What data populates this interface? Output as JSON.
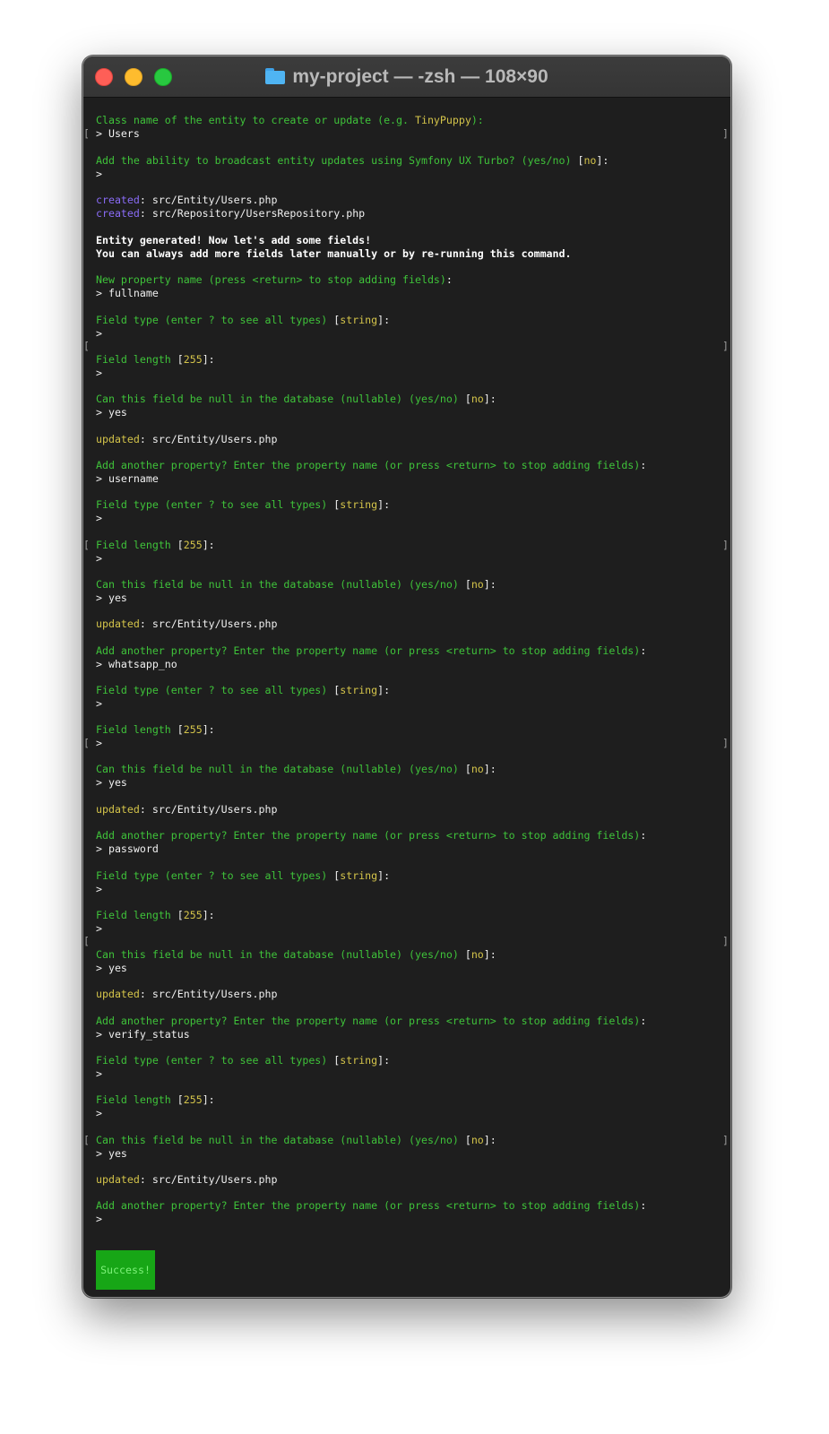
{
  "window": {
    "title": "my-project — -zsh — 108×90"
  },
  "prompt_symbol": "> ",
  "lines": {
    "l1": "Class name of the entity to create or update (e.g. ",
    "l1b": "TinyPuppy",
    "l1c": "):",
    "l2": "Users",
    "l3": "Add the ability to broadcast entity updates using Symfony UX Turbo? (yes/no) ",
    "l3b": "no",
    "l5a": "created",
    "l5b": ": src/Entity/Users.php",
    "l6a": "created",
    "l6b": ": src/Repository/UsersRepository.php",
    "l7": "Entity generated! Now let's add some fields!",
    "l8": "You can always add more fields later manually or by re-running this command.",
    "l9": "New property name (press <return> to stop adding fields)",
    "l10": "fullname",
    "field_type": "Field type (enter ? to see all types) ",
    "field_type_default": "string",
    "field_length": "Field length ",
    "field_length_default": "255",
    "nullable": "Can this field be null in the database (nullable) (yes/no) ",
    "nullable_default": "no",
    "yes": "yes",
    "updated": "updated",
    "updated_path": ": src/Entity/Users.php",
    "add_another": "Add another property? Enter the property name (or press <return> to stop adding fields)",
    "username": "username",
    "whatsapp_no": "whatsapp_no",
    "password": "password",
    "verify_status": "verify_status"
  },
  "success_label": "Success!",
  "colors": {
    "background": "#1e1e1e",
    "prompt_green": "#3fc33a",
    "default_yellow": "#d4c44a",
    "created_purple": "#8a6cf7",
    "success_bg": "#17a616"
  }
}
